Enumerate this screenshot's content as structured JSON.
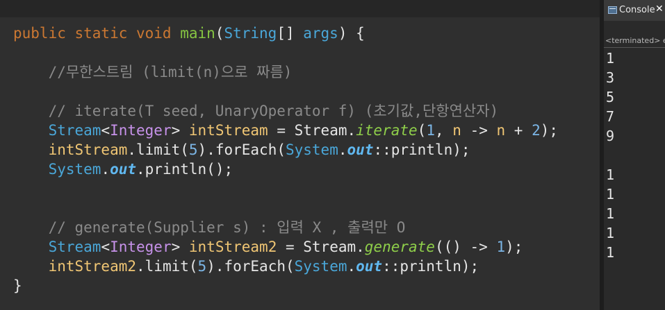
{
  "editor": {
    "lines": [
      {
        "tokens": [
          {
            "t": "public static void ",
            "c": "kw"
          },
          {
            "t": "main",
            "c": "mth"
          },
          {
            "t": "(",
            "c": "pl"
          },
          {
            "t": "String",
            "c": "typ"
          },
          {
            "t": "[] ",
            "c": "pl"
          },
          {
            "t": "args",
            "c": "typ"
          },
          {
            "t": ") {",
            "c": "pl"
          }
        ]
      },
      {
        "tokens": []
      },
      {
        "tokens": [
          {
            "t": "    //무한스트림 (limit(n)으로 짜름)",
            "c": "cmt"
          }
        ]
      },
      {
        "tokens": []
      },
      {
        "tokens": [
          {
            "t": "    // iterate(T seed, UnaryOperator f) (초기값,단항연산자)",
            "c": "cmt"
          }
        ]
      },
      {
        "tokens": [
          {
            "t": "    ",
            "c": "pl"
          },
          {
            "t": "Stream",
            "c": "typ"
          },
          {
            "t": "<",
            "c": "pl"
          },
          {
            "t": "Integer",
            "c": "cls"
          },
          {
            "t": "> ",
            "c": "pl"
          },
          {
            "t": "intStream",
            "c": "var"
          },
          {
            "t": " = Stream.",
            "c": "pl"
          },
          {
            "t": "iterate",
            "c": "smth"
          },
          {
            "t": "(",
            "c": "pl"
          },
          {
            "t": "1",
            "c": "num"
          },
          {
            "t": ", ",
            "c": "pl"
          },
          {
            "t": "n",
            "c": "var"
          },
          {
            "t": " -> ",
            "c": "pl"
          },
          {
            "t": "n",
            "c": "var"
          },
          {
            "t": " + ",
            "c": "pl"
          },
          {
            "t": "2",
            "c": "num"
          },
          {
            "t": ");",
            "c": "pl"
          }
        ]
      },
      {
        "tokens": [
          {
            "t": "    ",
            "c": "pl"
          },
          {
            "t": "intStream",
            "c": "var"
          },
          {
            "t": ".limit(",
            "c": "pl"
          },
          {
            "t": "5",
            "c": "num"
          },
          {
            "t": ").forEach(",
            "c": "pl"
          },
          {
            "t": "System",
            "c": "typ"
          },
          {
            "t": ".",
            "c": "pl"
          },
          {
            "t": "out",
            "c": "sfld"
          },
          {
            "t": "::println);",
            "c": "pl"
          }
        ]
      },
      {
        "tokens": [
          {
            "t": "    ",
            "c": "pl"
          },
          {
            "t": "System",
            "c": "typ"
          },
          {
            "t": ".",
            "c": "pl"
          },
          {
            "t": "out",
            "c": "sfld"
          },
          {
            "t": ".println();",
            "c": "pl"
          }
        ]
      },
      {
        "tokens": []
      },
      {
        "tokens": []
      },
      {
        "tokens": [
          {
            "t": "    // generate(Supplier s) : 입력 X , 출력만 O",
            "c": "cmt"
          }
        ]
      },
      {
        "tokens": [
          {
            "t": "    ",
            "c": "pl"
          },
          {
            "t": "Stream",
            "c": "typ"
          },
          {
            "t": "<",
            "c": "pl"
          },
          {
            "t": "Integer",
            "c": "cls"
          },
          {
            "t": "> ",
            "c": "pl"
          },
          {
            "t": "intStream2",
            "c": "var"
          },
          {
            "t": " = Stream.",
            "c": "pl"
          },
          {
            "t": "generate",
            "c": "smth"
          },
          {
            "t": "(() -> ",
            "c": "pl"
          },
          {
            "t": "1",
            "c": "num"
          },
          {
            "t": ");",
            "c": "pl"
          }
        ]
      },
      {
        "tokens": [
          {
            "t": "    ",
            "c": "pl"
          },
          {
            "t": "intStream2",
            "c": "var"
          },
          {
            "t": ".limit(",
            "c": "pl"
          },
          {
            "t": "5",
            "c": "num"
          },
          {
            "t": ").forEach(",
            "c": "pl"
          },
          {
            "t": "System",
            "c": "typ"
          },
          {
            "t": ".",
            "c": "pl"
          },
          {
            "t": "out",
            "c": "sfld"
          },
          {
            "t": "::println);",
            "c": "pl"
          }
        ]
      },
      {
        "tokens": [
          {
            "t": "}",
            "c": "pl"
          }
        ]
      }
    ]
  },
  "console": {
    "tab_label": "Console",
    "close_icon": "close-icon",
    "status": "<terminated> ex",
    "output": [
      "1",
      "3",
      "5",
      "7",
      "9",
      "",
      "1",
      "1",
      "1",
      "1",
      "1"
    ]
  },
  "colors": {
    "keyword": "#cc7832",
    "method": "#86c542",
    "type": "#4aa7d9",
    "class": "#c792ea",
    "variable": "#f0c674",
    "number": "#7cb6e6",
    "comment": "#8a8a8a",
    "background": "#2f2f2f"
  }
}
